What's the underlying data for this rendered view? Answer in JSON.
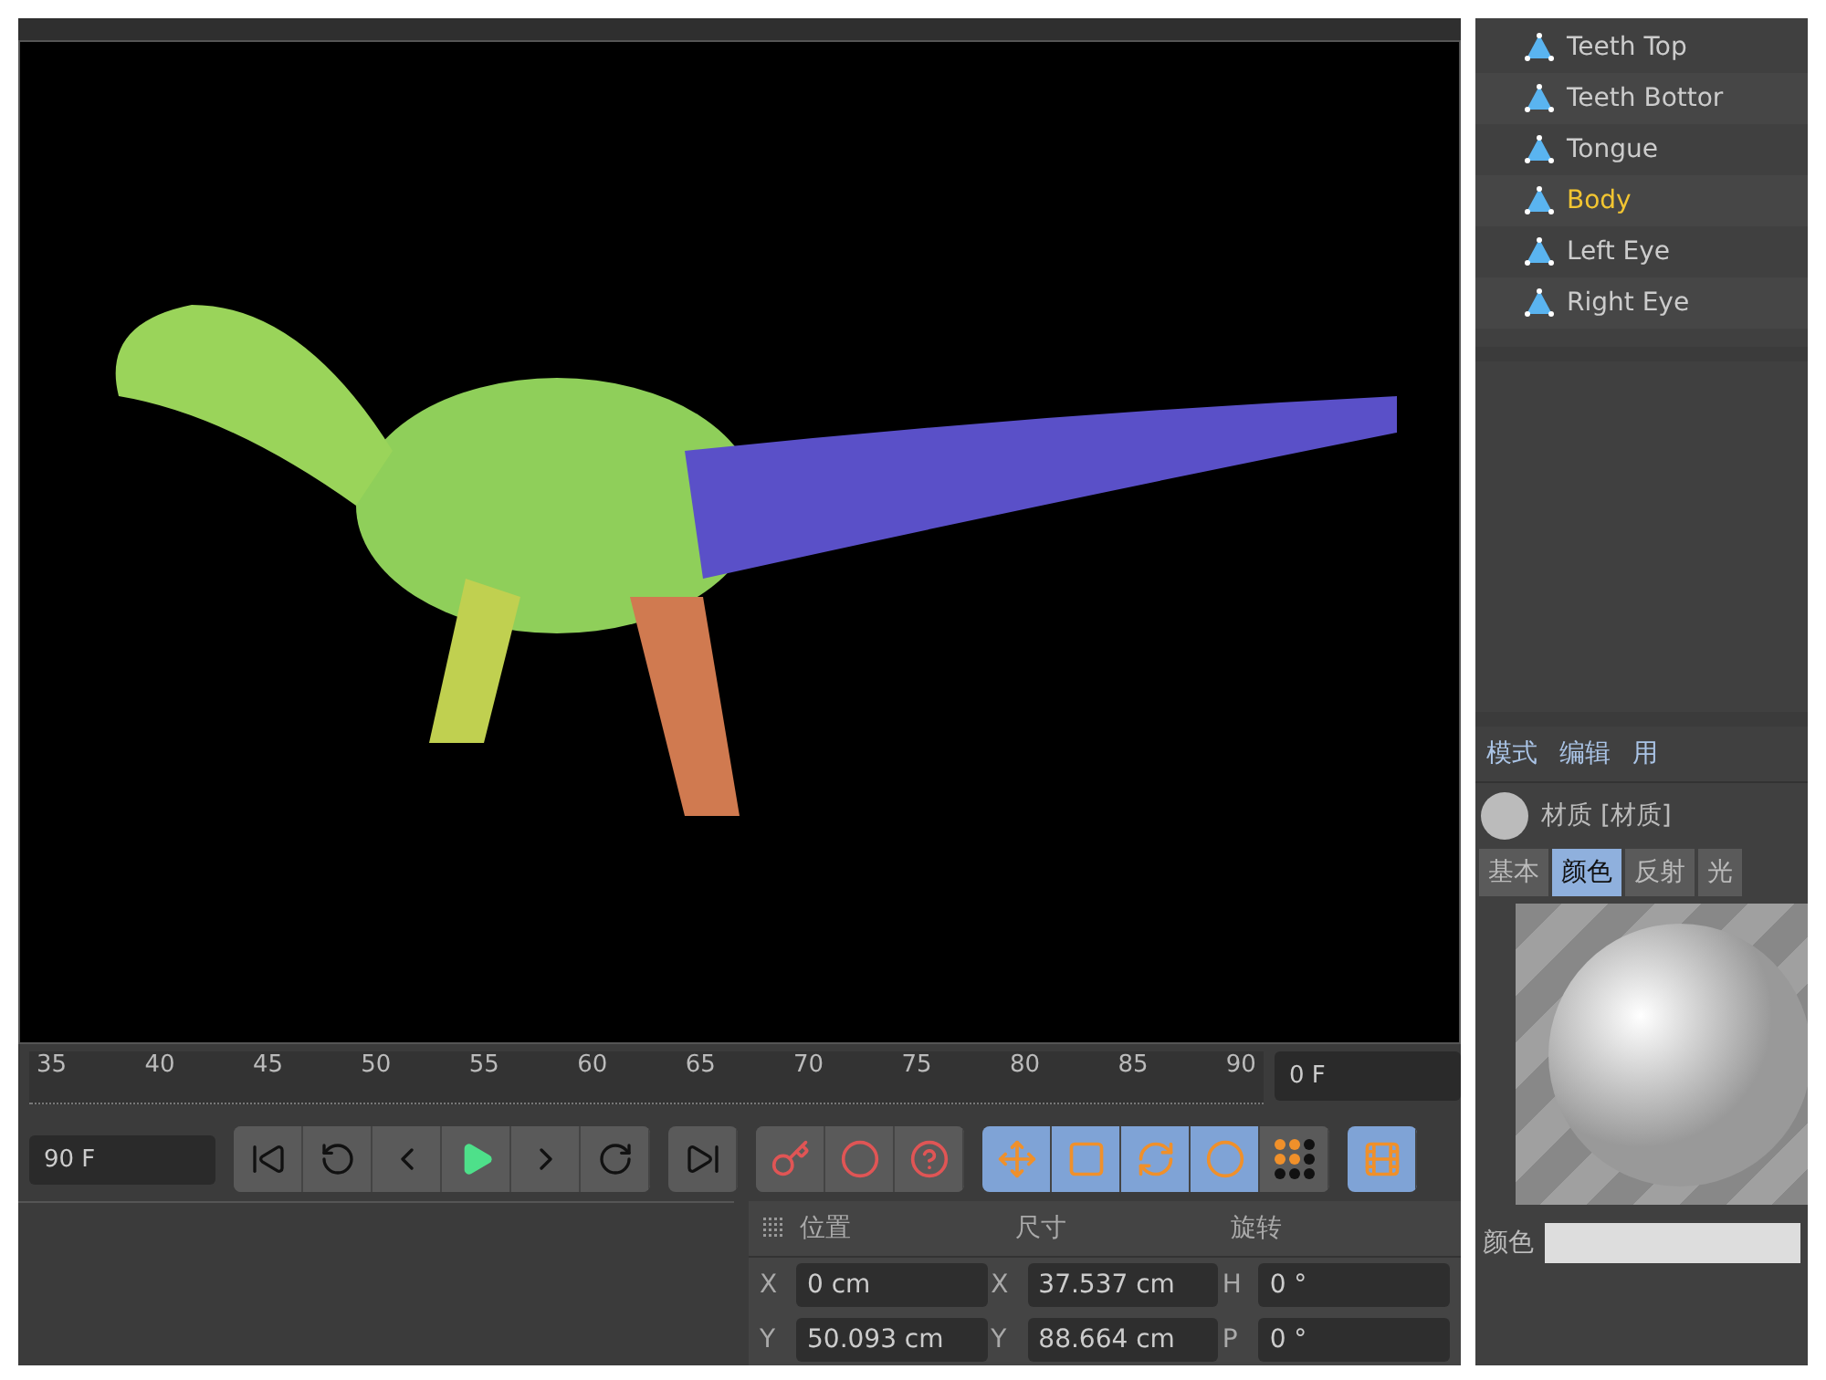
{
  "objects": [
    {
      "name": "Teeth Top",
      "selected": false
    },
    {
      "name": "Teeth Bottor",
      "selected": false
    },
    {
      "name": "Tongue",
      "selected": false
    },
    {
      "name": "Body",
      "selected": true
    },
    {
      "name": "Left Eye",
      "selected": false
    },
    {
      "name": "Right Eye",
      "selected": false
    }
  ],
  "timeline": {
    "ticks": [
      "35",
      "40",
      "45",
      "50",
      "55",
      "60",
      "65",
      "70",
      "75",
      "80",
      "85",
      "90"
    ],
    "current_frame": "0 F",
    "end_frame": "90 F"
  },
  "mode_tools": [
    {
      "selected": true
    },
    {
      "selected": true
    },
    {
      "selected": true
    },
    {
      "selected": true
    },
    {
      "selected": false
    }
  ],
  "timeline_toggle": {
    "selected": true
  },
  "attributes": {
    "menu": [
      "模式",
      "编辑",
      "用"
    ],
    "material_title": "材质 [材质]",
    "tabs": [
      {
        "label": "基本",
        "selected": false
      },
      {
        "label": "颜色",
        "selected": true
      },
      {
        "label": "反射",
        "selected": false
      },
      {
        "label": "光",
        "selected": false
      }
    ],
    "color_label": "颜色"
  },
  "coordinates": {
    "headers": [
      "位置",
      "尺寸",
      "旋转"
    ],
    "rows": [
      {
        "pos_axis": "X",
        "pos": "0 cm",
        "size_axis": "X",
        "size": "37.537 cm",
        "rot_axis": "H",
        "rot": "0 °"
      },
      {
        "pos_axis": "Y",
        "pos": "50.093 cm",
        "size_axis": "Y",
        "size": "88.664 cm",
        "rot_axis": "P",
        "rot": "0 °"
      }
    ]
  }
}
